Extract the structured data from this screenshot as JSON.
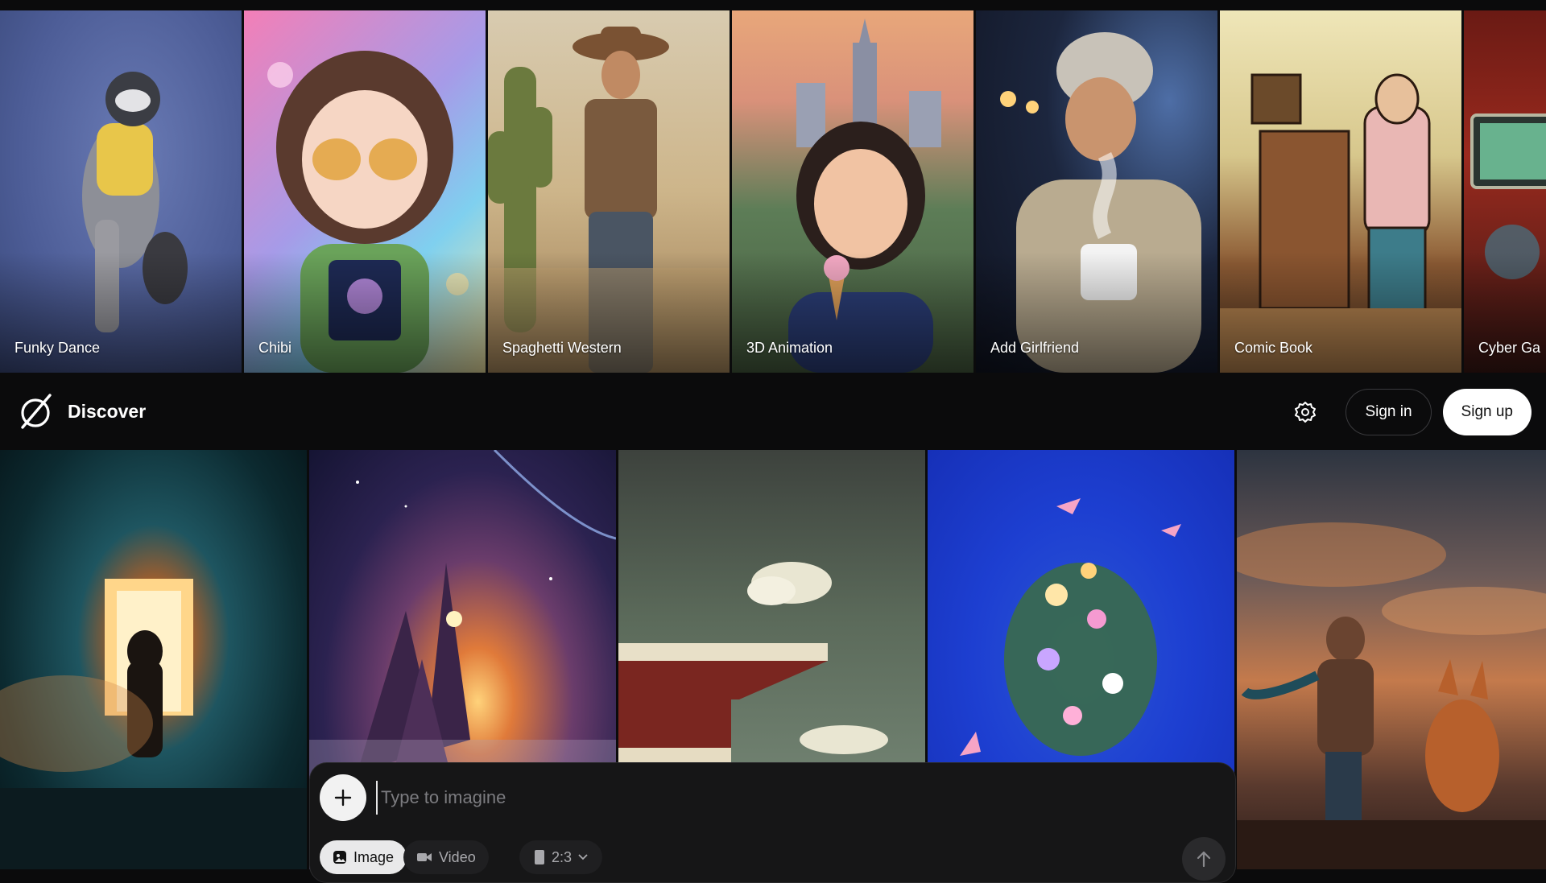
{
  "style_cards": [
    {
      "label": "Funky Dance"
    },
    {
      "label": "Chibi"
    },
    {
      "label": "Spaghetti Western"
    },
    {
      "label": "3D Animation"
    },
    {
      "label": "Add Girlfriend"
    },
    {
      "label": "Comic Book"
    },
    {
      "label": "Cyber Ga"
    }
  ],
  "header": {
    "title": "Discover",
    "logo_icon": "slashed-circle-logo-icon",
    "settings_icon": "gear-icon",
    "signin_label": "Sign in",
    "signup_label": "Sign up"
  },
  "composer": {
    "placeholder": "Type to imagine",
    "add_icon": "plus-icon",
    "modes": [
      {
        "label": "Image",
        "icon": "image-icon",
        "selected": true
      },
      {
        "label": "Video",
        "icon": "video-camera-icon",
        "selected": false
      }
    ],
    "aspect_ratio": "2:3",
    "submit_icon": "arrow-up-icon"
  },
  "colors": {
    "background": "#0b0b0c",
    "signup_bg": "#ffffff",
    "composer_bg": "#161617"
  }
}
